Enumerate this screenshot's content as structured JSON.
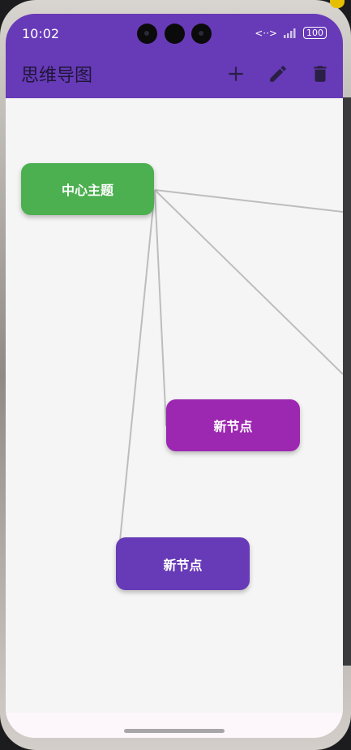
{
  "status_bar": {
    "time": "10:02",
    "signal_glyph": "<··>",
    "battery": "100"
  },
  "app_bar": {
    "title": "思维导图",
    "actions": [
      {
        "name": "add",
        "icon": "plus-icon"
      },
      {
        "name": "edit",
        "icon": "pencil-icon"
      },
      {
        "name": "delete",
        "icon": "trash-icon"
      }
    ]
  },
  "mind_map": {
    "nodes": [
      {
        "id": "center",
        "label": "中心主题",
        "color": "#4caf50"
      },
      {
        "id": "node1",
        "label": "新节点",
        "color": "#9c27b0"
      },
      {
        "id": "node2",
        "label": "新节点",
        "color": "#673ab7"
      }
    ],
    "link_color": "#bdbdbd"
  },
  "theme": {
    "primary": "#673ab7",
    "background": "#f5f5f5"
  }
}
